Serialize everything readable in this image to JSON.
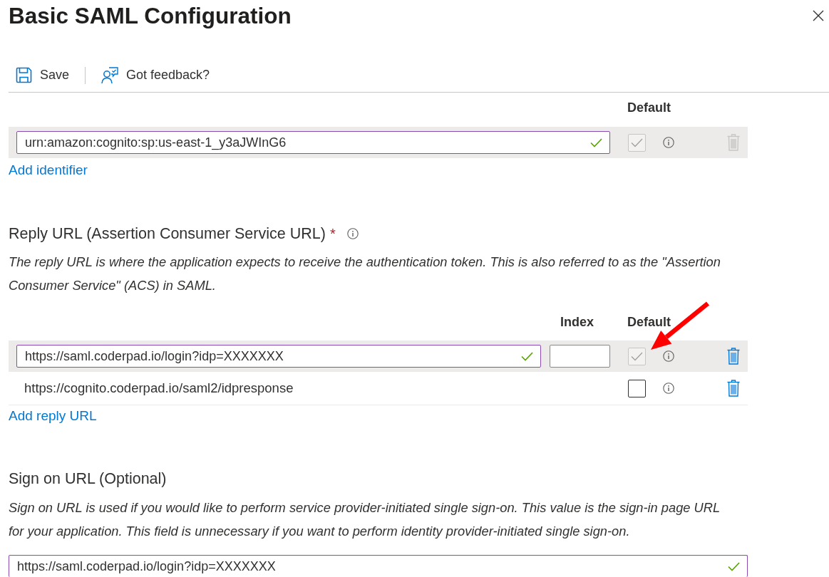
{
  "dialog": {
    "title": "Basic SAML Configuration"
  },
  "toolbar": [
    {
      "kind": "save",
      "label": "Save"
    },
    {
      "kind": "feedback",
      "label": "Got feedback?"
    }
  ],
  "identifier": {
    "columns": [
      {
        "kind": "default",
        "label": "Default"
      }
    ],
    "rows": [
      {
        "kind": "field",
        "value": "urn:amazon:cognito:sp:us-east-1_y3aJWInG6",
        "valid": true,
        "selected": true,
        "default_checked": true,
        "default_disabled": true,
        "delete_disabled": true
      }
    ],
    "add_link": "Add identifier"
  },
  "reply_url": {
    "label": "Reply URL (Assertion Consumer Service URL)",
    "required_mark": "*",
    "description": "The reply URL is where the application expects to receive the authentication token. This is also referred to as the \"Assertion Consumer Service\" (ACS) in SAML.",
    "columns": [
      {
        "kind": "index",
        "label": "Index"
      },
      {
        "kind": "default",
        "label": "Default"
      }
    ],
    "rows": [
      {
        "kind": "field",
        "value": "https://saml.coderpad.io/login?idp=XXXXXXX",
        "valid": true,
        "selected": true,
        "default_checked": true,
        "default_disabled": true,
        "delete_disabled": false
      },
      {
        "kind": "text",
        "value": "https://cognito.coderpad.io/saml2/idpresponse",
        "selected": false,
        "default_checked": false,
        "default_disabled": false,
        "delete_disabled": false
      }
    ],
    "add_link": "Add reply URL"
  },
  "sign_on_url": {
    "label": "Sign on URL (Optional)",
    "description": "Sign on URL is used if you would like to perform service provider-initiated single sign-on. This value is the sign-in page URL for your application. This field is unnecessary if you want to perform identity provider-initiated single sign-on.",
    "field": {
      "value": "https://saml.coderpad.io/login?idp=XXXXXXX",
      "valid": true
    }
  }
}
